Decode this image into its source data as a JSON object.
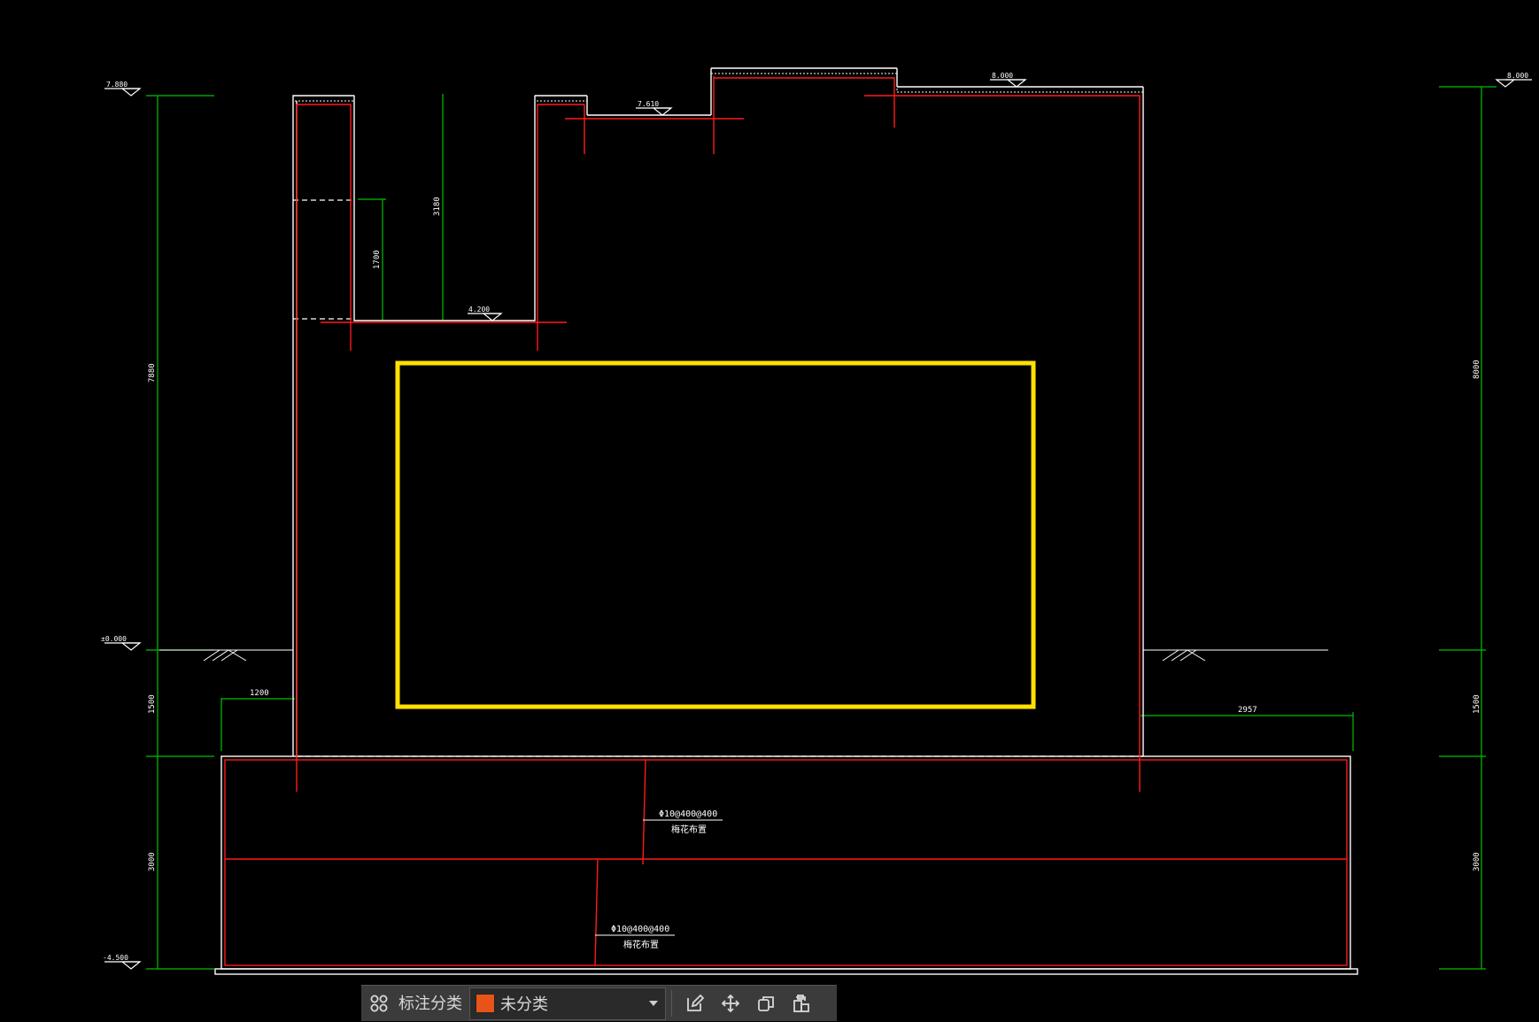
{
  "colors": {
    "background": "#000000",
    "outline": "#ffffff",
    "rebar": "#ff1a1a",
    "dimension": "#00c000",
    "highlight": "#ffe000",
    "category_swatch": "#e8531a",
    "toolbar_bg": "#3b3b3b"
  },
  "elevations": {
    "left_top": "7.880",
    "left_zero": "±0.000",
    "left_bottom": "-4.500",
    "right_top": "8.000",
    "mid_top": "8.000",
    "step_level": "7.610",
    "inner_level": "4.200"
  },
  "dimensions": {
    "left_total": "7880",
    "left_mid": "1500",
    "left_bottom": "3000",
    "right_total": "8000",
    "right_mid": "1500",
    "right_bottom": "3000",
    "inner_height": "3180",
    "inner_small": "1700",
    "left_offset": "1200",
    "right_offset": "2957"
  },
  "annotations": {
    "rebar_upper_line1": "Φ10@400@400",
    "rebar_upper_line2": "梅花布置",
    "rebar_lower_line1": "Φ10@400@400",
    "rebar_lower_line2": "梅花布置"
  },
  "toolbar": {
    "grid_icon": "grid-icon",
    "category_label": "标注分类",
    "category_value": "未分类",
    "edit_icon": "edit-icon",
    "move_icon": "move-icon",
    "copy_icon": "copy-icon",
    "paste_icon": "paste-icon"
  }
}
